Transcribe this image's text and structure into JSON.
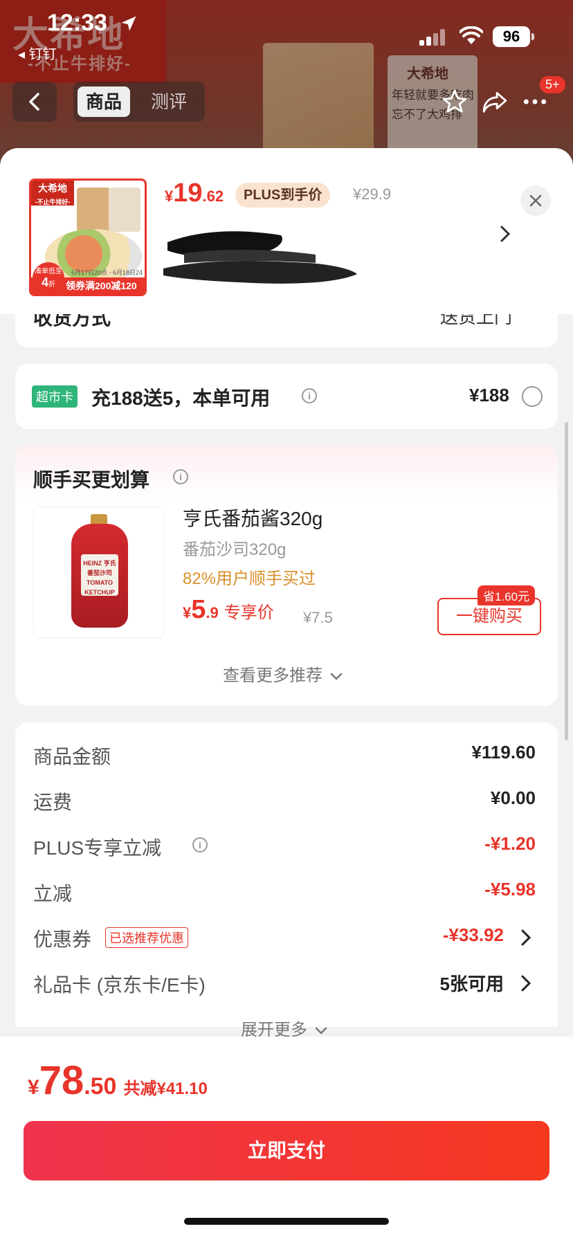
{
  "status_bar": {
    "time": "12:33",
    "back_app": "◂ 钉钉",
    "battery": "96"
  },
  "background_page": {
    "logo_text": "大希地",
    "logo_sub": "-不止牛排好-",
    "pack_brand": "大希地",
    "pack_text": "年轻就要多吃肉 忘不了大鸡排",
    "tabs": [
      "商品",
      "测评"
    ],
    "badge": "5+"
  },
  "product": {
    "thumb_brand": "大希地",
    "thumb_brand_sub": "-不止牛排好-",
    "thumb_circle_top": "凑单低至",
    "thumb_circle_num": "4",
    "thumb_circle_unit": "折",
    "thumb_dates": "6月17日20点 - 6月18日24点",
    "thumb_coupon": "领券满200减120",
    "price_symbol": "¥",
    "price_int": "19",
    "price_dec": ".62",
    "plus_tag": "PLUS到手价",
    "price_orig": "¥29.9"
  },
  "shipping": {
    "label": "收货方式",
    "value": "送货上门"
  },
  "super_card": {
    "badge": "超市卡",
    "text": "充188送5，本单可用",
    "price": "¥188"
  },
  "recommend": {
    "title": "顺手买更划算",
    "item_name": "亨氏番茄酱320g",
    "item_spec": "番茄沙司320g",
    "item_buyers": "82%用户顺手买过",
    "bottle_label": "HEINZ 亨氏番茄沙司 TOMATO KETCHUP",
    "price_symbol": "¥",
    "price_int": "5",
    "price_dec": ".9",
    "price_label": "专享价",
    "price_orig": "¥7.5",
    "save_tag": "省1.60元",
    "buy_button": "一键购买",
    "see_more": "查看更多推荐"
  },
  "summary": {
    "rows": [
      {
        "label": "商品金额",
        "value": "¥119.60"
      },
      {
        "label": "运费",
        "value": "¥0.00"
      },
      {
        "label": "PLUS专享立减",
        "value": "-¥1.20"
      },
      {
        "label": "立减",
        "value": "-¥5.98"
      },
      {
        "label": "优惠券",
        "tag": "已选推荐优惠",
        "value": "-¥33.92"
      },
      {
        "label": "礼品卡 (京东卡/E卡)",
        "value": "5张可用"
      }
    ],
    "expand": "展开更多"
  },
  "footer": {
    "total_symbol": "¥",
    "total_int": "78",
    "total_dec": ".50",
    "total_saved": "共减¥41.10",
    "pay_button": "立即支付"
  },
  "colors": {
    "accent": "#e8342a",
    "super_badge": "#2fb57a",
    "plus_tag_bg": "#f9e2cf",
    "buyers_text": "#d9902b"
  }
}
